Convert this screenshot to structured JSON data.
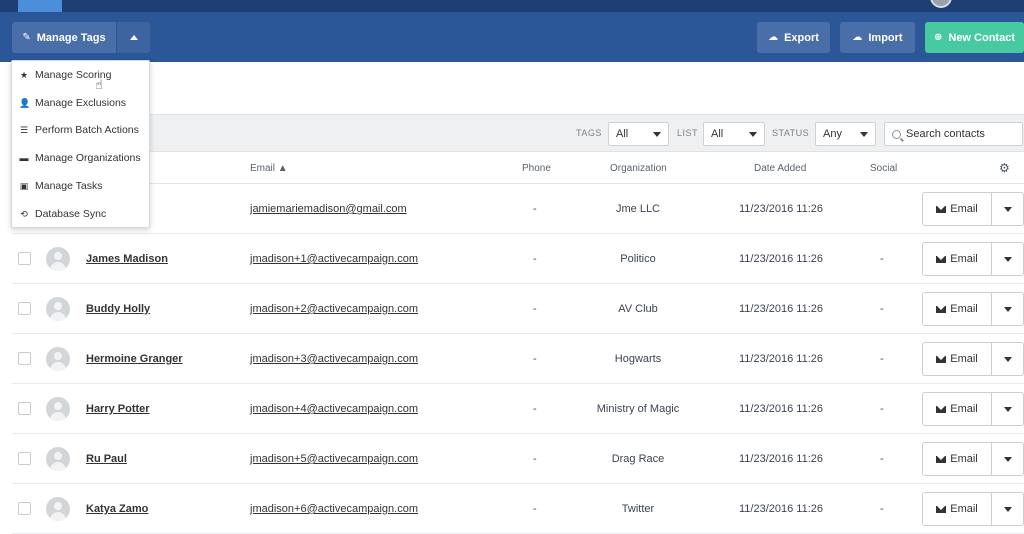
{
  "toolbar": {
    "manage_tags_label": "Manage Tags",
    "export_label": "Export",
    "import_label": "Import",
    "new_contact_label": "New Contact"
  },
  "menu": {
    "items": [
      {
        "label": "Manage Scoring",
        "icon": "star-icon"
      },
      {
        "label": "Manage Exclusions",
        "icon": "user-icon"
      },
      {
        "label": "Perform Batch Actions",
        "icon": "list-icon"
      },
      {
        "label": "Manage Organizations",
        "icon": "briefcase-icon"
      },
      {
        "label": "Manage Tasks",
        "icon": "calendar-icon"
      },
      {
        "label": "Database Sync",
        "icon": "sync-icon"
      }
    ]
  },
  "filters": {
    "tags_label": "TAGS",
    "tags_value": "All",
    "list_label": "LIST",
    "list_value": "All",
    "status_label": "STATUS",
    "status_value": "Any",
    "search_placeholder": "Search contacts"
  },
  "columns": {
    "email": "Email ▲",
    "phone": "Phone",
    "organization": "Organization",
    "date_added": "Date Added",
    "social": "Social"
  },
  "rows": [
    {
      "name": "",
      "email": "jamiemariemadison@gmail.com",
      "phone": "-",
      "org": "Jme LLC",
      "date": "11/23/2016 11:26",
      "social": "",
      "action": "Email"
    },
    {
      "name": "James Madison",
      "email": "jmadison+1@activecampaign.com",
      "phone": "-",
      "org": "Politico",
      "date": "11/23/2016 11:26",
      "social": "-",
      "action": "Email"
    },
    {
      "name": "Buddy Holly",
      "email": "jmadison+2@activecampaign.com",
      "phone": "-",
      "org": "AV Club",
      "date": "11/23/2016 11:26",
      "social": "-",
      "action": "Email"
    },
    {
      "name": "Hermoine Granger",
      "email": "jmadison+3@activecampaign.com",
      "phone": "-",
      "org": "Hogwarts",
      "date": "11/23/2016 11:26",
      "social": "-",
      "action": "Email"
    },
    {
      "name": "Harry Potter",
      "email": "jmadison+4@activecampaign.com",
      "phone": "-",
      "org": "Ministry of Magic",
      "date": "11/23/2016 11:26",
      "social": "-",
      "action": "Email"
    },
    {
      "name": "Ru Paul",
      "email": "jmadison+5@activecampaign.com",
      "phone": "-",
      "org": "Drag Race",
      "date": "11/23/2016 11:26",
      "social": "-",
      "action": "Email"
    },
    {
      "name": "Katya Zamo",
      "email": "jmadison+6@activecampaign.com",
      "phone": "-",
      "org": "Twitter",
      "date": "11/23/2016 11:26",
      "social": "-",
      "action": "Email"
    }
  ],
  "colors": {
    "toolbar": "#2b5798",
    "topbar": "#1e3f72",
    "new_contact": "#47c9a2"
  }
}
